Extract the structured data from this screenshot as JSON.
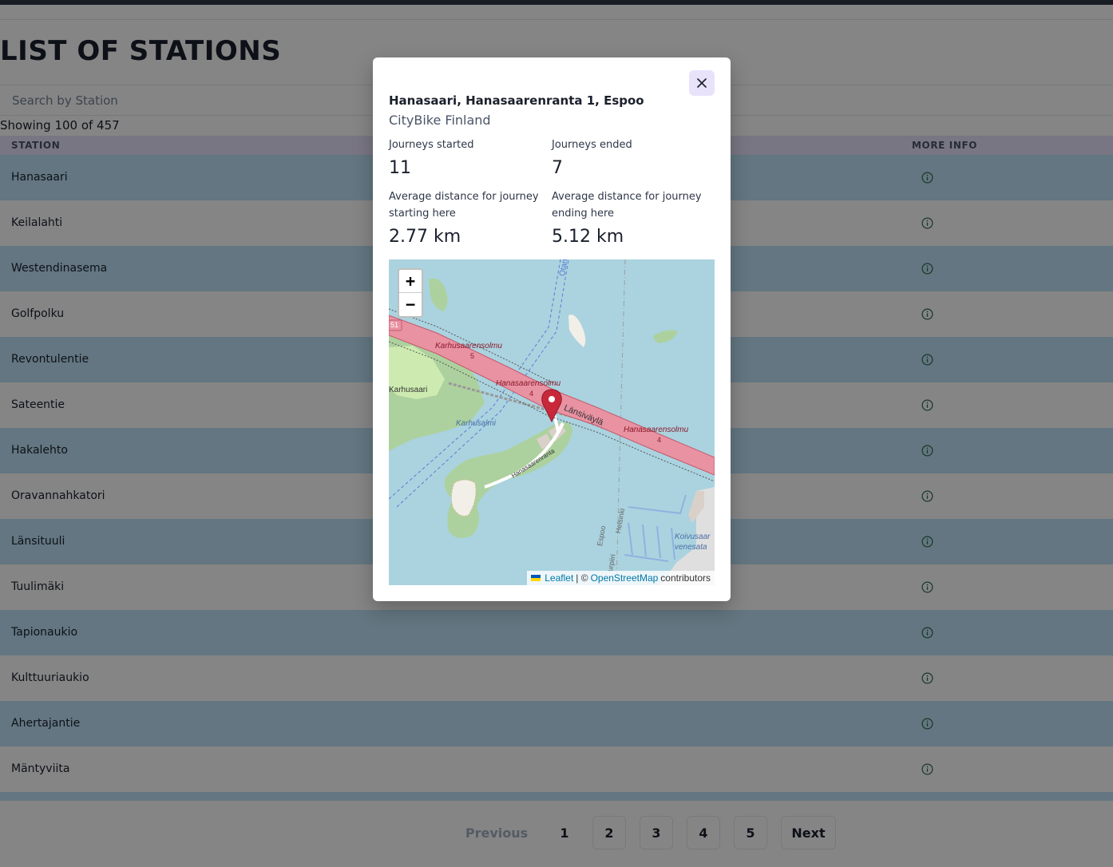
{
  "page": {
    "title": "LIST OF STATIONS",
    "search_placeholder": "Search by Station",
    "showing_text": "Showing 100 of 457"
  },
  "table": {
    "headers": {
      "station": "STATION",
      "more_info": "MORE INFO"
    },
    "rows": [
      {
        "name": "Hanasaari"
      },
      {
        "name": "Keilalahti"
      },
      {
        "name": "Westendinasema"
      },
      {
        "name": "Golfpolku"
      },
      {
        "name": "Revontulentie"
      },
      {
        "name": "Sateentie"
      },
      {
        "name": "Hakalehto"
      },
      {
        "name": "Oravannahkatori"
      },
      {
        "name": "Länsituuli"
      },
      {
        "name": "Tuulimäki"
      },
      {
        "name": "Tapionaukio"
      },
      {
        "name": "Kulttuuriaukio"
      },
      {
        "name": "Ahertajantie"
      },
      {
        "name": "Mäntyviita"
      }
    ]
  },
  "pagination": {
    "previous": "Previous",
    "pages": [
      "1",
      "2",
      "3",
      "4",
      "5"
    ],
    "next": "Next",
    "current_page": 1
  },
  "modal": {
    "title": "Hanasaari, Hanasaarenranta 1, Espoo",
    "operator": "CityBike Finland",
    "journeys_started_label": "Journeys started",
    "journeys_started": "11",
    "journeys_ended_label": "Journeys ended",
    "journeys_ended": "7",
    "avg_start_label": "Average distance for journey starting here",
    "avg_start": "2.77 km",
    "avg_end_label": "Average distance for journey ending here",
    "avg_end": "5.12 km",
    "map": {
      "zoom_in": "+",
      "zoom_out": "−",
      "attribution_leaflet": "Leaflet",
      "attribution_sep": "| ©",
      "attribution_osm": "OpenStreetMap",
      "attribution_tail": "contributors",
      "labels": {
        "karhusaarensolmu": "Karhusaarensolmu",
        "karhusaarensolmu_num": "5",
        "hanasaarensolmu_a": "Hanasaarensolmu",
        "hanasaarensolmu_a_num": "4",
        "hanasaarensolmu_b": "Hanasaarensolmu",
        "hanasaarensolmu_b_num": "4",
        "lansivayla": "Länsiväylä",
        "karhusaari": "Karhusaari",
        "karhusalmi": "Karhusalmi",
        "hanasaarenranta": "Hanasaarenranta",
        "espoo": "Espoo",
        "helsinki": "Helsinki",
        "koivusaari_1": "Koivusaar",
        "koivusaari_2": "venesata",
        "route_51": "51",
        "otaniemi": "Otanien",
        "urpiiri": "urpiiri"
      }
    }
  },
  "colors": {
    "row_highlight": "#bee3f8",
    "header_bg": "#e9e2fb",
    "marker": "#c8283a",
    "water": "#aad3df",
    "land": "#add19e",
    "motorway": "#e892a2"
  },
  "icons": {
    "close": "close-icon",
    "info": "info-circle-icon",
    "marker": "map-marker-icon",
    "flag": "ukraine-flag-icon"
  }
}
